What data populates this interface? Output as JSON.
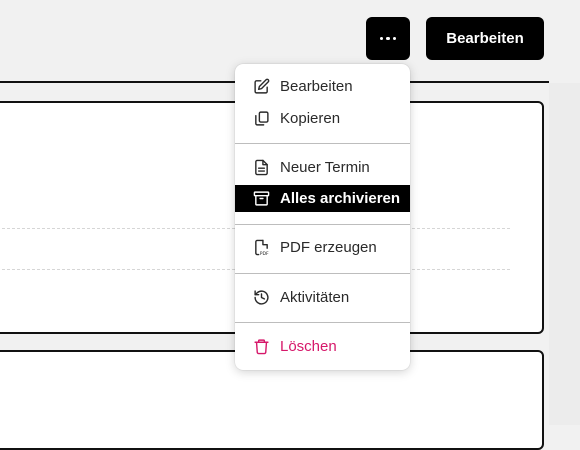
{
  "header": {
    "more_button_icon": "more-dots-icon",
    "edit_button_label": "Bearbeiten"
  },
  "menu": {
    "items": [
      {
        "label": "Bearbeiten",
        "icon": "pencil-square-icon"
      },
      {
        "label": "Kopieren",
        "icon": "copy-icon"
      },
      {
        "label": "Neuer Termin",
        "icon": "document-icon"
      },
      {
        "label": "Alles archivieren",
        "icon": "archive-icon",
        "highlighted": true
      },
      {
        "label": "PDF erzeugen",
        "icon": "pdf-file-icon"
      },
      {
        "label": "Aktivitäten",
        "icon": "history-icon"
      },
      {
        "label": "Löschen",
        "icon": "trash-icon",
        "color": "#d6186a"
      }
    ]
  },
  "colors": {
    "accent": "#000000",
    "danger": "#d6186a",
    "background": "#f1f1f1"
  }
}
